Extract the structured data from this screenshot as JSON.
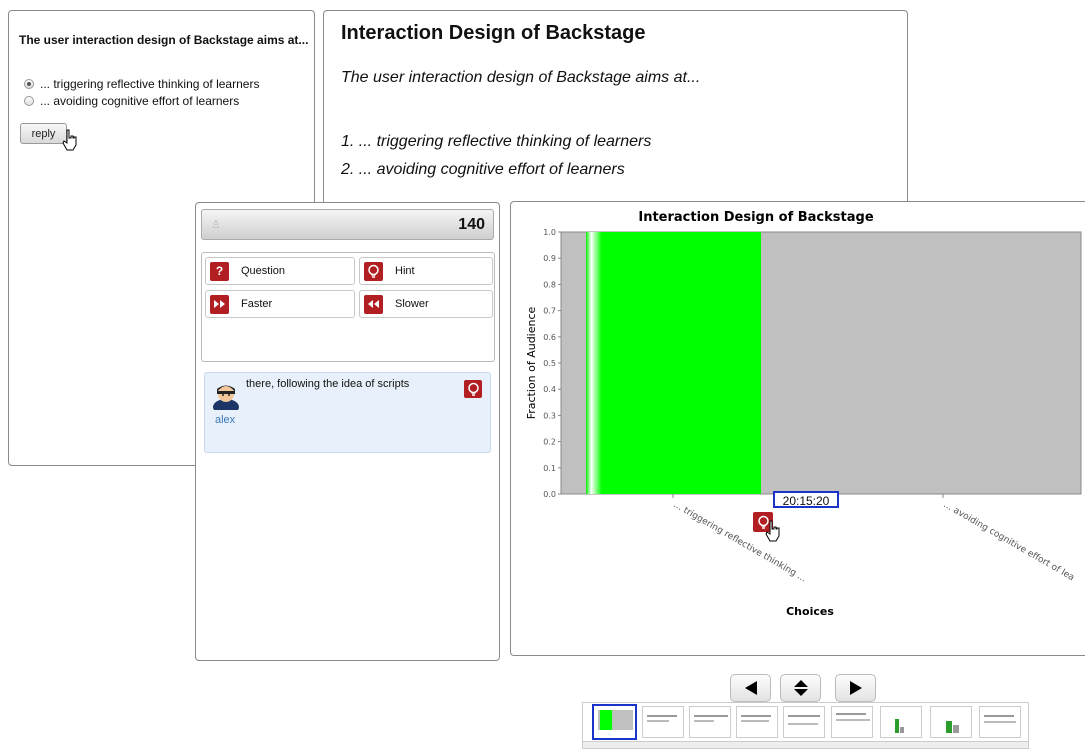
{
  "quiz": {
    "question": "The user interaction design of Backstage aims at...",
    "options": [
      "... triggering reflective thinking of learners",
      "... avoiding cognitive effort of learners"
    ],
    "selected_index": 0,
    "reply_label": "reply"
  },
  "slide": {
    "title": "Interaction Design of Backstage",
    "question": "The user interaction design of Backstage aims at...",
    "options": [
      "1. ... triggering reflective thinking of learners",
      "2. ... avoiding cognitive effort of learners"
    ]
  },
  "backchannel": {
    "count": "140",
    "actions": [
      {
        "label": "Question",
        "icon": "question-icon"
      },
      {
        "label": "Hint",
        "icon": "bulb-icon"
      },
      {
        "label": "Faster",
        "icon": "fast-forward-icon"
      },
      {
        "label": "Slower",
        "icon": "rewind-icon"
      }
    ],
    "message": {
      "author": "alex",
      "text": "there, following the idea of scripts",
      "icon": "bulb-icon"
    }
  },
  "chart_data": {
    "type": "bar",
    "title": "Interaction Design of Backstage",
    "xlabel": "Choices",
    "ylabel": "Fraction of Audience",
    "categories": [
      "... triggering reflective thinking ...",
      "... avoiding cognitive effort of lea"
    ],
    "values": [
      1.0,
      0.0
    ],
    "ylim": [
      0,
      1.0
    ],
    "yticks": [
      "0.0",
      "0.1",
      "0.2",
      "0.3",
      "0.4",
      "0.5",
      "0.6",
      "0.7",
      "0.8",
      "0.9",
      "1.0"
    ],
    "bar_color": "#00ff00",
    "plot_background": "#c0c0c0",
    "time_label": "20:15:20"
  },
  "navigation": {
    "prev_icon": "left-triangle-icon",
    "toggle_icon": "up-down-icon",
    "next_icon": "right-triangle-icon"
  },
  "colors": {
    "accent_red": "#b11f22",
    "highlight_blue": "#1a33c8"
  }
}
